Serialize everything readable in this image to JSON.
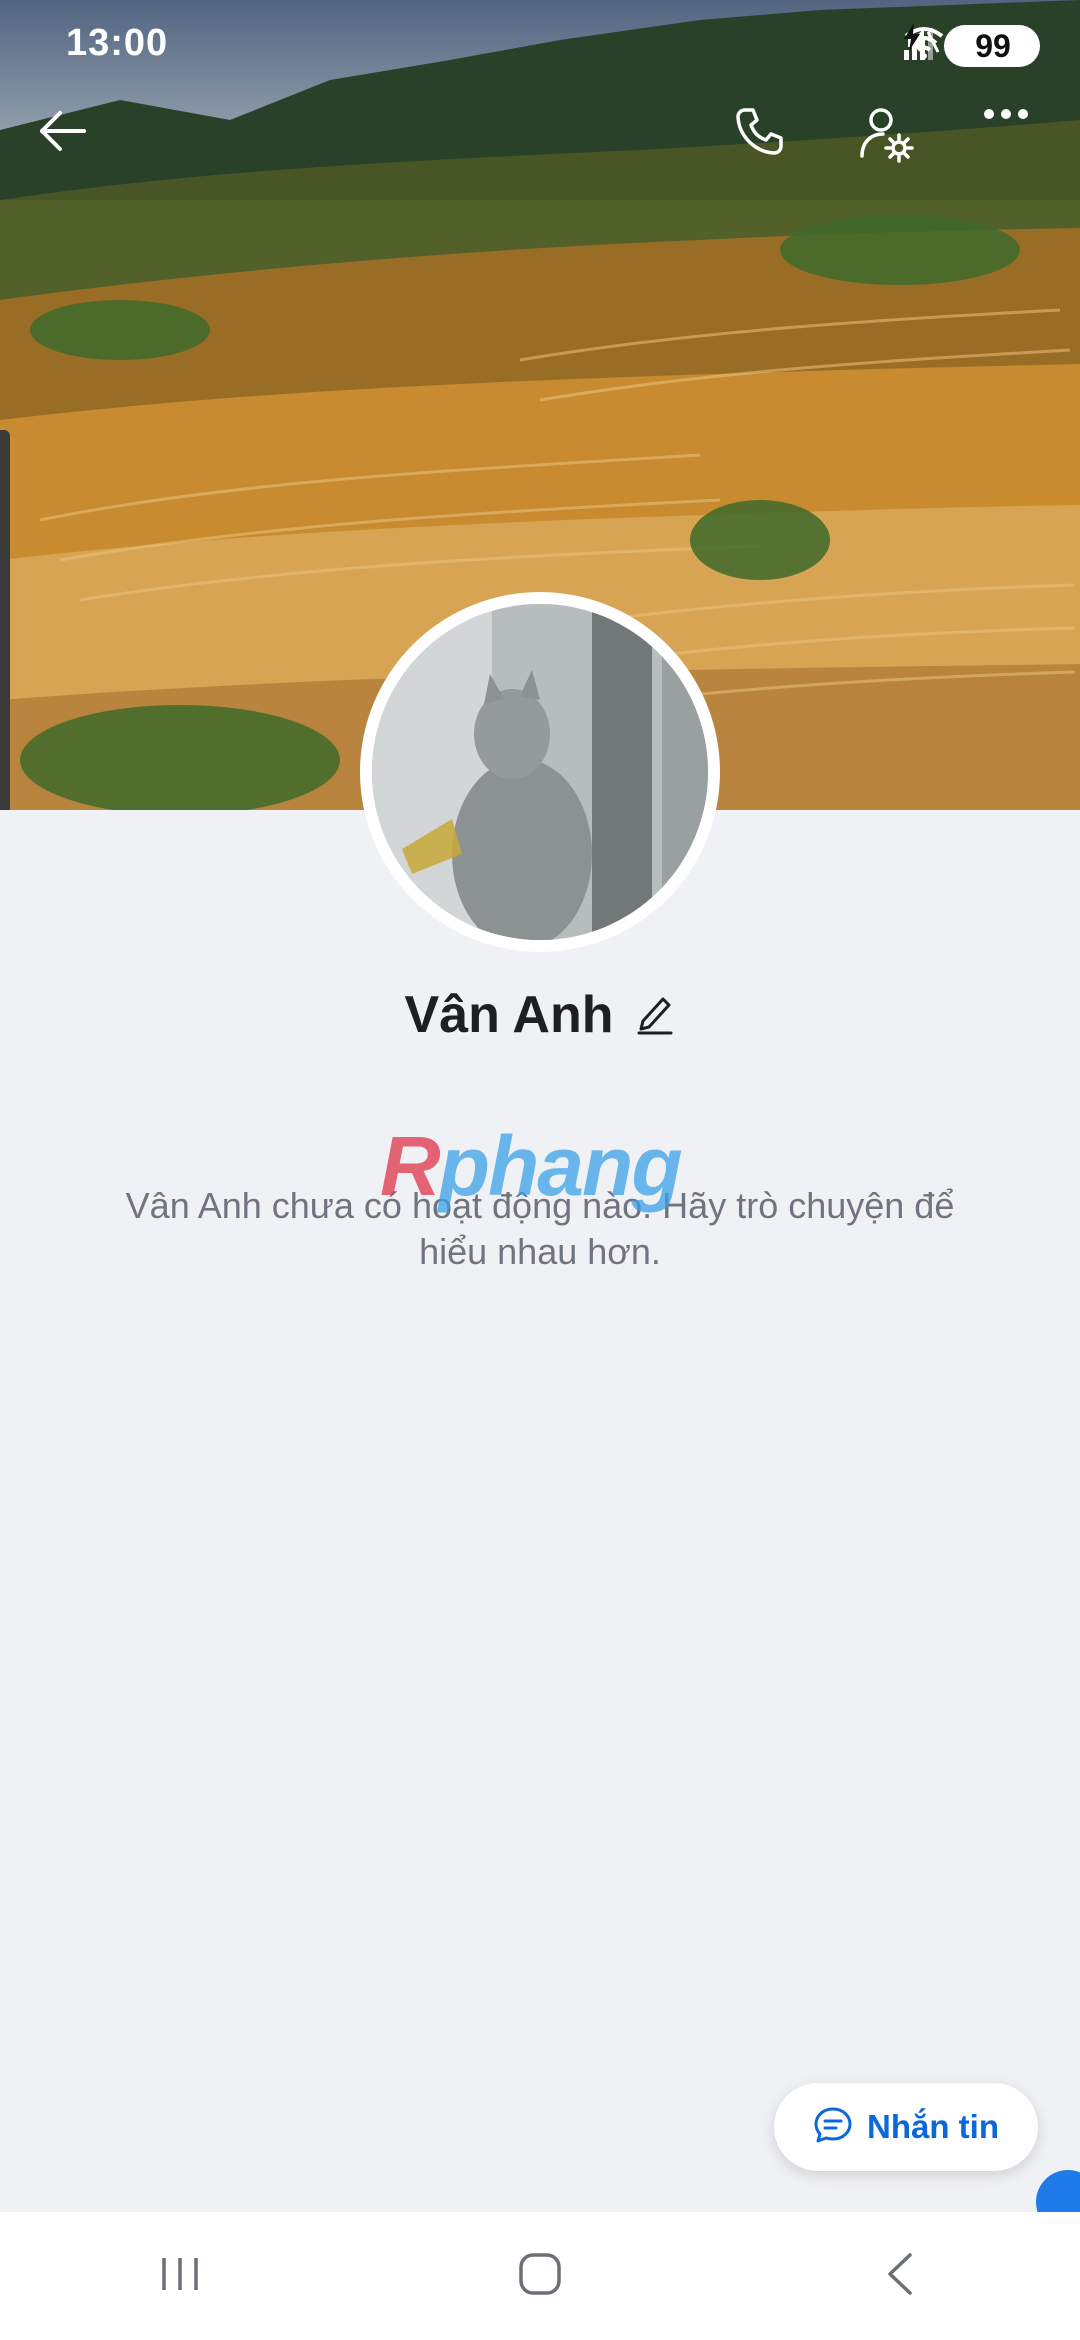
{
  "status_bar": {
    "time": "13:00",
    "battery": "99"
  },
  "top_bar": {
    "back_icon": "arrow-left-icon",
    "call_icon": "phone-icon",
    "settings_icon": "user-gear-icon",
    "more_icon": "more-dots-icon"
  },
  "profile": {
    "name": "Vân Anh",
    "edit_icon": "pencil-icon",
    "empty_message": "Vân Anh chưa có hoạt động nào. Hãy trò chuyện để hiểu nhau hơn."
  },
  "watermark": {
    "first": "R",
    "rest": "phang"
  },
  "actions": {
    "message_label": "Nhắn tin",
    "message_icon": "chat-bubble-icon"
  },
  "navigation": {
    "recents_icon": "recent-apps-icon",
    "home_icon": "home-icon",
    "back_icon": "nav-back-icon"
  },
  "colors": {
    "accent": "#0a68d9",
    "background": "#f0f1f5",
    "text_primary": "#1d1f23",
    "text_secondary": "#6e7580"
  }
}
